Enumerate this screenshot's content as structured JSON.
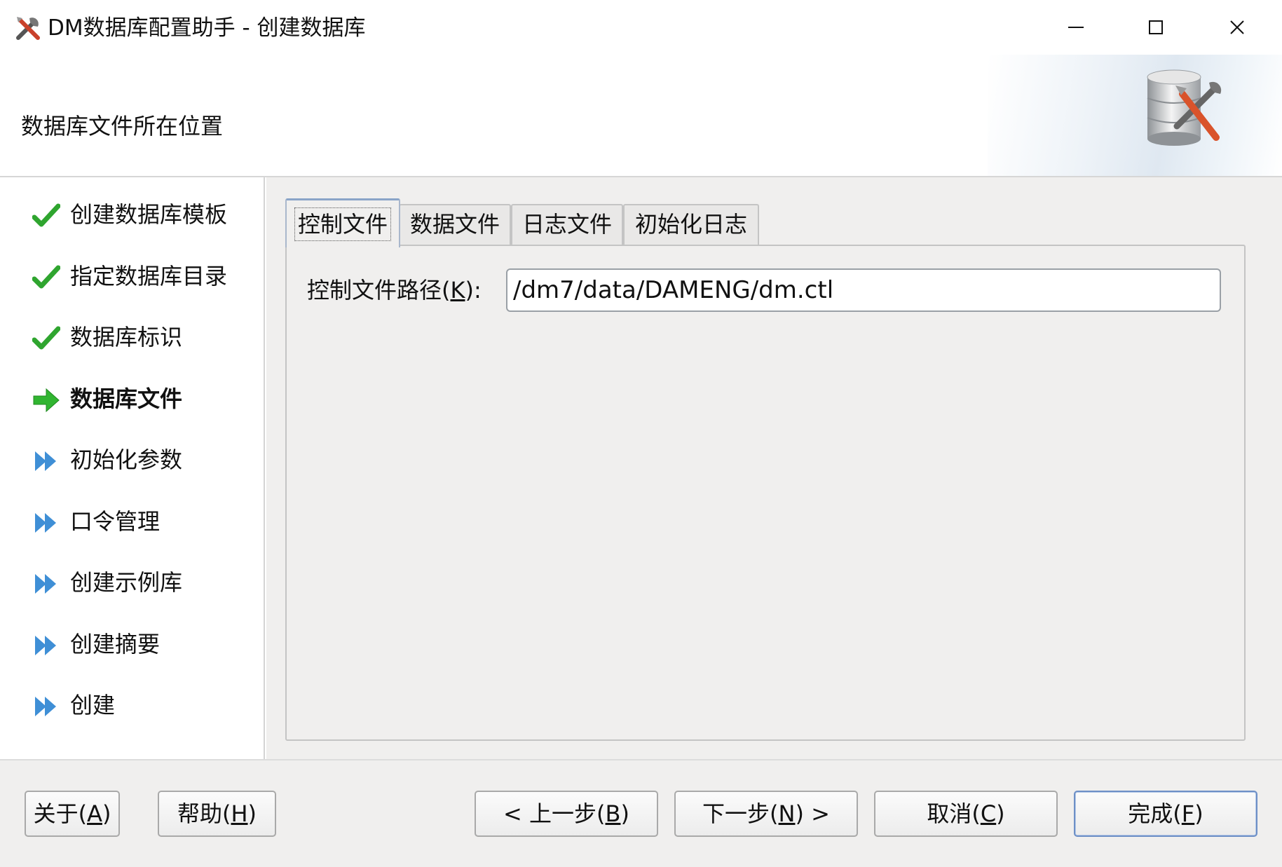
{
  "window": {
    "title": "DM数据库配置助手 - 创建数据库",
    "controls": [
      "minimize-icon",
      "maximize-icon",
      "close-icon"
    ]
  },
  "header": {
    "title": "数据库文件所在位置"
  },
  "sidebar": {
    "items": [
      {
        "label": "创建数据库模板",
        "status": "done",
        "icon": "check-icon"
      },
      {
        "label": "指定数据库目录",
        "status": "done",
        "icon": "check-icon"
      },
      {
        "label": "数据库标识",
        "status": "done",
        "icon": "check-icon"
      },
      {
        "label": "数据库文件",
        "status": "current",
        "icon": "arrow-right-icon"
      },
      {
        "label": "初始化参数",
        "status": "pending",
        "icon": "double-arrow-icon"
      },
      {
        "label": "口令管理",
        "status": "pending",
        "icon": "double-arrow-icon"
      },
      {
        "label": "创建示例库",
        "status": "pending",
        "icon": "double-arrow-icon"
      },
      {
        "label": "创建摘要",
        "status": "pending",
        "icon": "double-arrow-icon"
      },
      {
        "label": "创建",
        "status": "pending",
        "icon": "double-arrow-icon"
      }
    ]
  },
  "tabs": [
    {
      "label": "控制文件",
      "active": true
    },
    {
      "label": "数据文件",
      "active": false
    },
    {
      "label": "日志文件",
      "active": false
    },
    {
      "label": "初始化日志",
      "active": false
    }
  ],
  "control_file": {
    "label_prefix": "控制文件路径(",
    "label_mnemonic": "K",
    "label_suffix": "):",
    "path_value": "/dm7/data/DAMENG/dm.ctl"
  },
  "buttons": {
    "about": {
      "prefix": "关于(",
      "mnemonic": "A",
      "suffix": ")"
    },
    "help": {
      "prefix": "帮助(",
      "mnemonic": "H",
      "suffix": ")"
    },
    "back": {
      "prefix": "< 上一步(",
      "mnemonic": "B",
      "suffix": ")"
    },
    "next": {
      "prefix": "下一步(",
      "mnemonic": "N",
      "suffix": ") >"
    },
    "cancel": {
      "prefix": "取消(",
      "mnemonic": "C",
      "suffix": ")"
    },
    "finish": {
      "prefix": "完成(",
      "mnemonic": "F",
      "suffix": ")"
    }
  },
  "colors": {
    "check_green": "#2fa52f",
    "current_arrow_green": "#31b531",
    "pending_arrow_blue": "#3f8fd6",
    "panel_bg": "#f0efee",
    "default_button_border": "#6d8fc6"
  }
}
